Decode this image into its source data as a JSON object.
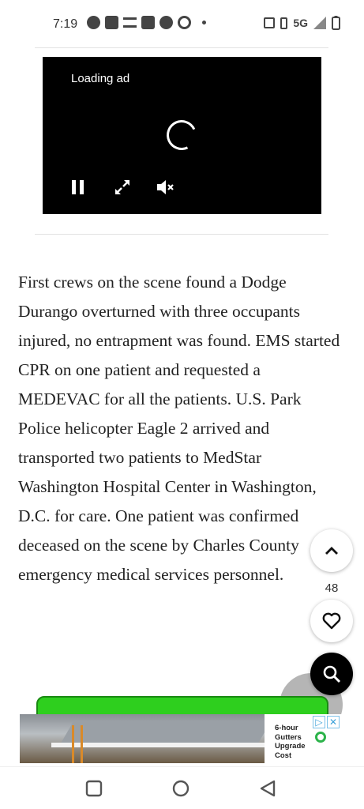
{
  "status_bar": {
    "time": "7:19",
    "network": "5G",
    "left_icons": [
      "messenger-icon",
      "news-icon",
      "text-icon",
      "video-icon",
      "facebook-icon",
      "chrome-icon"
    ],
    "right_icons": [
      "nfc-icon",
      "vibrate-icon",
      "signal-icon",
      "battery-icon"
    ]
  },
  "video_ad": {
    "loading_text": "Loading ad",
    "controls": [
      "pause-icon",
      "fullscreen-icon",
      "mute-icon"
    ]
  },
  "article": {
    "paragraphs": [
      "First crews on the scene found a Dodge Durango overturned with three occupants injured, no entrapment was found. EMS started CPR on one patient and requested a MEDEVAC for all the patients. U.S. Park",
      "Police helicopter Eagle 2 arrived and transported two patients to MedStar Washington Hospital Center in Washington, D.C. for care. One patient was confirmed deceased on the scene by Charles County emergency medical services personnel."
    ]
  },
  "floating": {
    "like_count": "48"
  },
  "banner_ad": {
    "text": "6-hour Gutters Upgrade Cost"
  },
  "colors": {
    "video_bg": "#000000",
    "green_bar": "#2ecf1e",
    "search_fab": "#000000"
  }
}
